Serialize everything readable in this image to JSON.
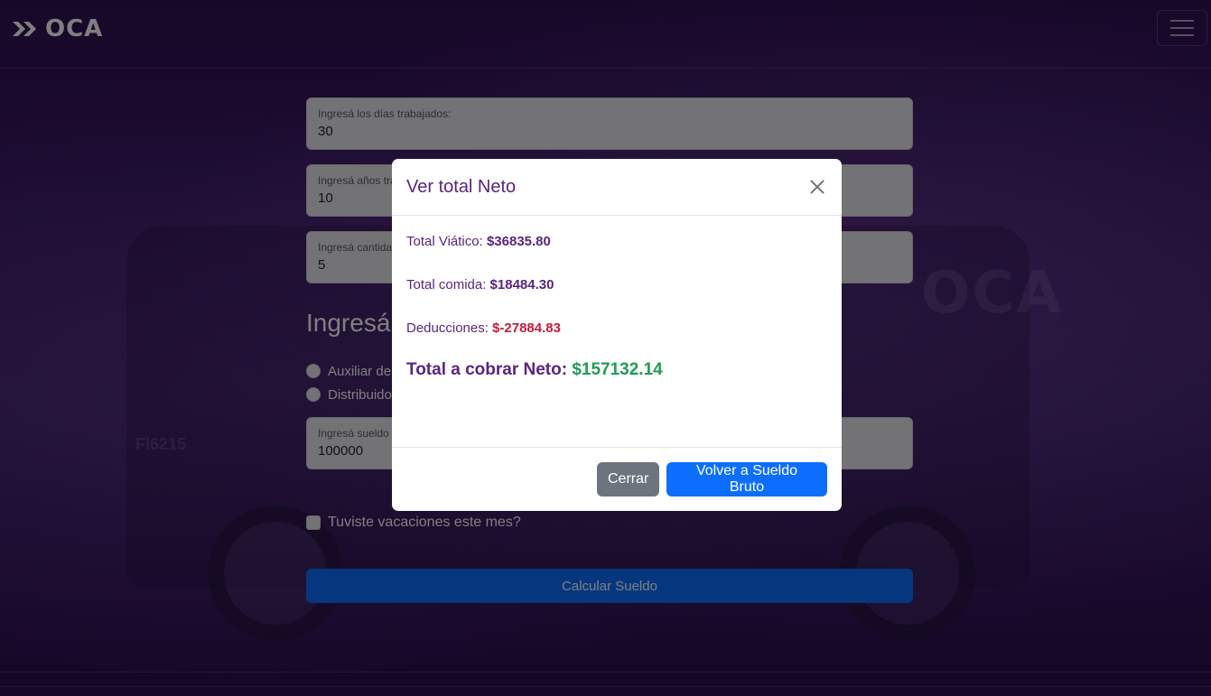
{
  "brand": {
    "name": "OCA",
    "icon": "double-chevron-logo-icon"
  },
  "navbar": {
    "toggle_icon": "hamburger-menu-icon"
  },
  "background": {
    "watermark_logo": "OCA",
    "truck_plate": "FI6215"
  },
  "form": {
    "fields": [
      {
        "label": "Ingresá los días trabajados:",
        "value": "30"
      },
      {
        "label": "Ingresá años trabajados:",
        "value": "10"
      },
      {
        "label": "Ingresá cantidad:",
        "value": "5"
      }
    ],
    "section_title": "Ingresá",
    "radios": [
      {
        "label": "Auxiliar de"
      },
      {
        "label": "Distribuidor"
      }
    ],
    "salary_field": {
      "label": "Ingresá sueldo",
      "value": "100000"
    },
    "vacation_checkbox": {
      "label": "Tuviste vacaciones este mes?"
    },
    "calculate_button": "Calcular Sueldo"
  },
  "modal": {
    "title": "Ver total Neto",
    "close_icon": "close-icon",
    "lines": [
      {
        "label": "Total Viático:",
        "value": "$36835.80"
      },
      {
        "label": "Total comida:",
        "value": "$18484.30"
      },
      {
        "label": "Deducciones:",
        "value": "$-27884.83"
      }
    ],
    "total": {
      "label": "Total a cobrar Neto:",
      "value": "$157132.14"
    },
    "buttons": {
      "close": "Cerrar",
      "back": "Volver a Sueldo Bruto"
    }
  },
  "colors": {
    "brand_purple": "#5a2480",
    "negative": "#c41e3a",
    "positive": "#1f9d55",
    "primary": "#0d6efd",
    "secondary": "#6c757d"
  }
}
